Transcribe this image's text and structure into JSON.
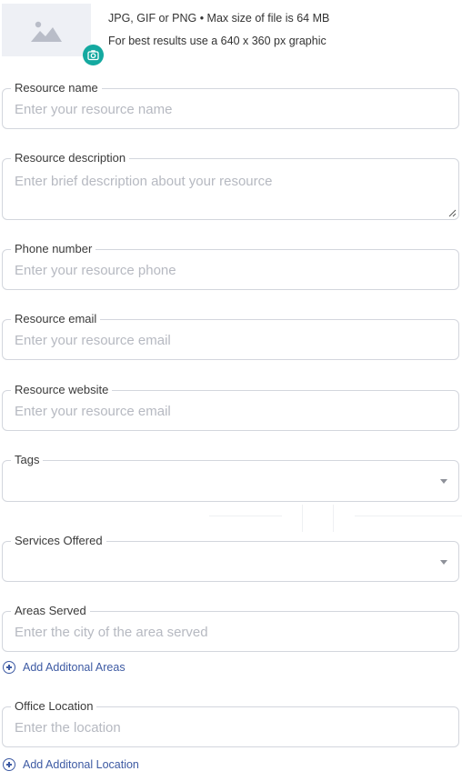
{
  "upload": {
    "hint_line1": "JPG, GIF or PNG • Max size of file is 64 MB",
    "hint_line2": "For best results use a 640 x 360 px graphic",
    "thumb_icon": "image-placeholder-icon",
    "camera_icon": "camera-icon",
    "accent_color": "#14a9a0"
  },
  "fields": {
    "resource_name": {
      "label": "Resource name",
      "placeholder": "Enter your resource name",
      "value": ""
    },
    "resource_description": {
      "label": "Resource description",
      "placeholder": "Enter brief description about your resource",
      "value": ""
    },
    "phone_number": {
      "label": "Phone number",
      "placeholder": "Enter your resource phone",
      "value": ""
    },
    "resource_email": {
      "label": "Resource email",
      "placeholder": "Enter your resource email",
      "value": ""
    },
    "resource_website": {
      "label": "Resource website",
      "placeholder": "Enter your resource email",
      "value": ""
    },
    "tags": {
      "label": "Tags",
      "value": ""
    },
    "services_offered": {
      "label": "Services Offered",
      "value": ""
    },
    "areas_served": {
      "label": "Areas Served",
      "placeholder": "Enter the city of the area served",
      "value": ""
    },
    "office_location": {
      "label": "Office Location",
      "placeholder": "Enter the location",
      "value": ""
    }
  },
  "links": {
    "add_areas": "Add Additonal Areas",
    "add_location": "Add Additonal Location",
    "link_color": "#3d5aa3"
  }
}
